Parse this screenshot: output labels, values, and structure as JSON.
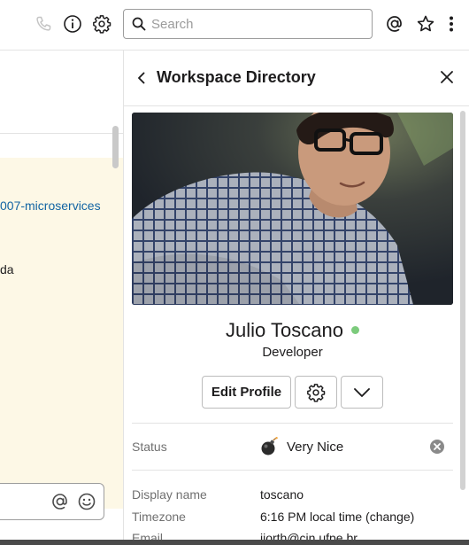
{
  "topbar": {
    "search_placeholder": "Search",
    "icons": [
      "phone-icon",
      "info-icon",
      "gear-icon",
      "search-icon",
      "mention-icon",
      "star-icon",
      "more-icon"
    ]
  },
  "left_pane": {
    "link_fragment": "007-microservices",
    "text_fragment": "da"
  },
  "panel": {
    "title": "Workspace Directory",
    "profile": {
      "name": "Julio Toscano",
      "title": "Developer",
      "presence_color": "#7ccb7c"
    },
    "buttons": {
      "edit_profile": "Edit Profile"
    },
    "fields": {
      "status_label": "Status",
      "status_value": "Very Nice",
      "display_name_label": "Display name",
      "display_name_value": "toscano",
      "timezone_label": "Timezone",
      "timezone_value": "6:16 PM local time (change)",
      "email_label": "Email",
      "email_value": "jjorth@cin.ufpe.br"
    }
  },
  "colors": {
    "link": "#1264a3",
    "highlight": "#fdf8e6",
    "presence": "#7ccb7c"
  }
}
